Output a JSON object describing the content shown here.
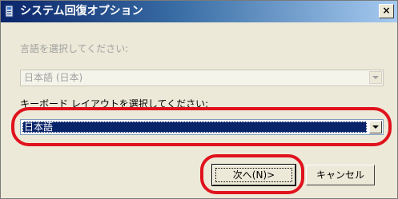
{
  "window": {
    "title": "システム回復オプション",
    "close_label": "×"
  },
  "language": {
    "label": "言語を選択してください:",
    "selected": "日本語 (日本)"
  },
  "keyboard": {
    "label": "キーボード レイアウトを選択してください:",
    "selected": "日本語"
  },
  "buttons": {
    "next_label": "次へ(N)>",
    "cancel_label": "キャンセル"
  },
  "colors": {
    "highlight_ring": "#e0121d",
    "selection": "#0a246a"
  }
}
